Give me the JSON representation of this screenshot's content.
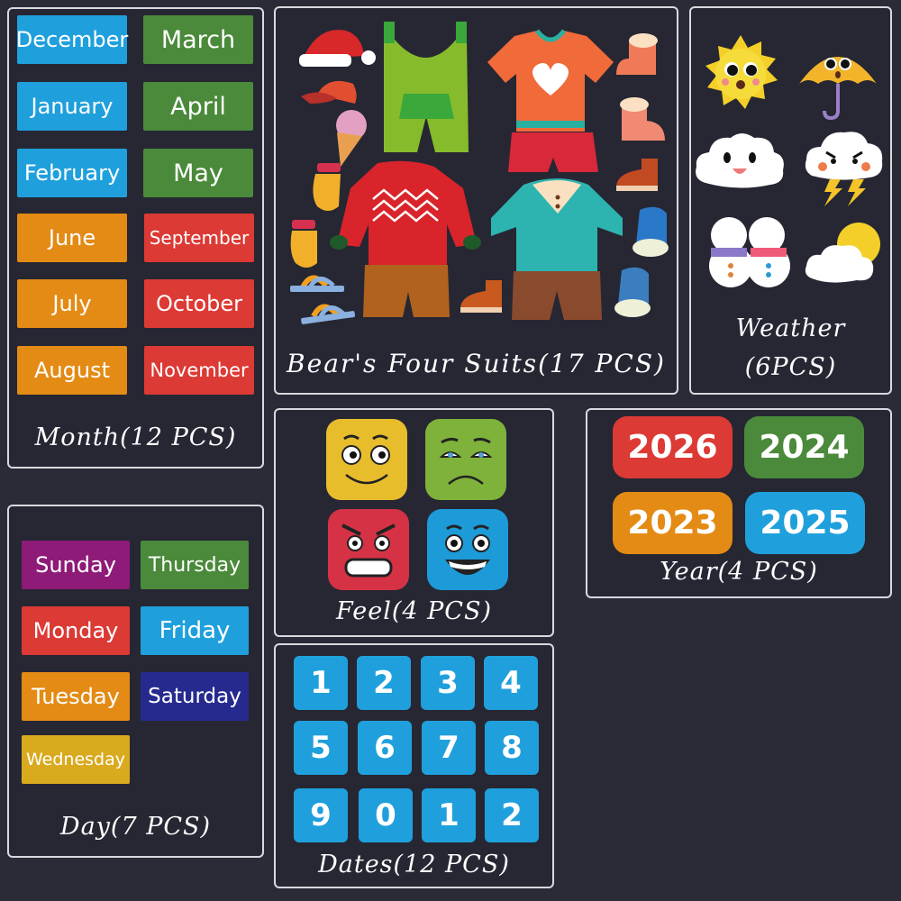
{
  "colors": {
    "background": "#2a2b36",
    "panel_border": "#d9d9de",
    "blue": "#1fa0dc",
    "green": "#4a8a3a",
    "orange": "#e38b15",
    "red": "#dc3a35",
    "purple": "#8e1b78",
    "navy": "#262a8f",
    "yellow": "#d9aa1e"
  },
  "month": {
    "title": "Month(12 PCS)",
    "left_column": [
      {
        "label": "December",
        "color": "#1fa0dc"
      },
      {
        "label": "January",
        "color": "#1fa0dc"
      },
      {
        "label": "February",
        "color": "#1fa0dc"
      },
      {
        "label": "June",
        "color": "#e38b15"
      },
      {
        "label": "July",
        "color": "#e38b15"
      },
      {
        "label": "August",
        "color": "#e38b15"
      }
    ],
    "right_column": [
      {
        "label": "March",
        "color": "#4a8a3a"
      },
      {
        "label": "April",
        "color": "#4a8a3a"
      },
      {
        "label": "May",
        "color": "#4a8a3a"
      },
      {
        "label": "September",
        "color": "#dc3a35"
      },
      {
        "label": "October",
        "color": "#dc3a35"
      },
      {
        "label": "November",
        "color": "#dc3a35"
      }
    ]
  },
  "day": {
    "title": "Day(7 PCS)",
    "items": [
      {
        "label": "Sunday",
        "color": "#8e1b78"
      },
      {
        "label": "Thursday",
        "color": "#4a8a3a"
      },
      {
        "label": "Monday",
        "color": "#dc3a35"
      },
      {
        "label": "Friday",
        "color": "#1fa0dc"
      },
      {
        "label": "Tuesday",
        "color": "#e38b15"
      },
      {
        "label": "Saturday",
        "color": "#262a8f"
      },
      {
        "label": "Wednesday",
        "color": "#d9aa1e"
      }
    ]
  },
  "suits": {
    "title": "Bear's Four Suits(17 PCS)",
    "items": [
      "santa-hat",
      "cap",
      "ice-cream",
      "mitten",
      "mitten",
      "sandal",
      "sandal",
      "green-overalls",
      "orange-tshirt-heart",
      "red-shorts",
      "red-sweater",
      "brown-pants",
      "teal-polo",
      "brown-trousers",
      "fur-boot",
      "fur-boot",
      "brown-shoe",
      "brown-shoe",
      "blue-sneaker",
      "blue-sneaker"
    ]
  },
  "weather": {
    "title_line1": "Weather",
    "title_line2": "(6PCS)",
    "items": [
      "sun",
      "umbrella",
      "cloud",
      "thunder-cloud",
      "snowmen",
      "sun-cloud"
    ]
  },
  "feel": {
    "title": "Feel(4 PCS)",
    "items": [
      {
        "mood": "happy",
        "color": "#e8bd2c"
      },
      {
        "mood": "sad",
        "color": "#7fb23a"
      },
      {
        "mood": "angry",
        "color": "#d63246"
      },
      {
        "mood": "excited",
        "color": "#1d9ad8"
      }
    ]
  },
  "year": {
    "title": "Year(4 PCS)",
    "items": [
      {
        "label": "2026",
        "color": "#dc3a35"
      },
      {
        "label": "2024",
        "color": "#4a8a3a"
      },
      {
        "label": "2023",
        "color": "#e38b15"
      },
      {
        "label": "2025",
        "color": "#1fa0dc"
      }
    ]
  },
  "dates": {
    "title": "Dates(12 PCS)",
    "items": [
      "1",
      "2",
      "3",
      "4",
      "5",
      "6",
      "7",
      "8",
      "9",
      "0",
      "1",
      "2"
    ]
  }
}
